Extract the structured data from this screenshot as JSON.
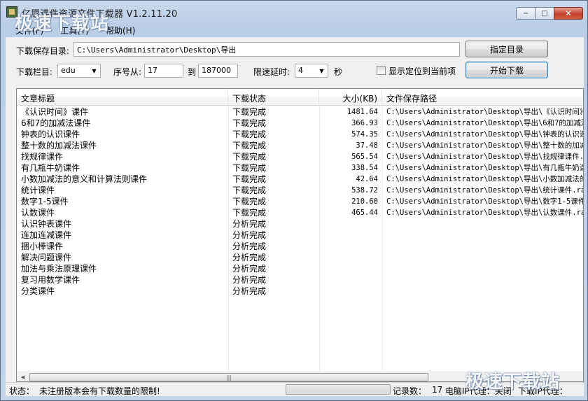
{
  "window": {
    "title": "亿愿课件资源文件下载器 V1.2.11.20",
    "watermark": "极速下载站",
    "minimize": "−",
    "maximize": "□",
    "close": "✕"
  },
  "menu": [
    "文件(F)",
    "工具(T)",
    "帮助(H)"
  ],
  "form": {
    "save_dir_label": "下载保存目录:",
    "save_dir_value": "C:\\Users\\Administrator\\Desktop\\导出",
    "choose_dir_button": "指定目录",
    "column_label": "下载栏目:",
    "column_value": "edu",
    "seq_from_label": "序号从:",
    "seq_from_value": "17",
    "seq_to_label": "到",
    "seq_to_value": "187000",
    "delay_label": "限速延时:",
    "delay_value": "4",
    "delay_unit": "秒",
    "locate_checkbox_label": "显示定位到当前项",
    "locate_checked": false,
    "start_button": "开始下载"
  },
  "table": {
    "headers": [
      "文章标题",
      "下载状态",
      "大小(KB)",
      "文件保存路径"
    ],
    "rows": [
      {
        "title": "《认识时间》课件",
        "status": "下载完成",
        "size": "1481.64",
        "path": "C:\\Users\\Administrator\\Desktop\\导出\\《认识时间》"
      },
      {
        "title": "6和7的加减法课件",
        "status": "下载完成",
        "size": "366.93",
        "path": "C:\\Users\\Administrator\\Desktop\\导出\\6和7的加减法"
      },
      {
        "title": "钟表的认识课件",
        "status": "下载完成",
        "size": "574.35",
        "path": "C:\\Users\\Administrator\\Desktop\\导出\\钟表的认识课"
      },
      {
        "title": "整十数的加减法课件",
        "status": "下载完成",
        "size": "37.48",
        "path": "C:\\Users\\Administrator\\Desktop\\导出\\整十数的加减"
      },
      {
        "title": "找规律课件",
        "status": "下载完成",
        "size": "565.54",
        "path": "C:\\Users\\Administrator\\Desktop\\导出\\找规律课件.ra"
      },
      {
        "title": "有几瓶牛奶课件",
        "status": "下载完成",
        "size": "338.54",
        "path": "C:\\Users\\Administrator\\Desktop\\导出\\有几瓶牛奶课"
      },
      {
        "title": "小数加减法的意义和计算法则课件",
        "status": "下载完成",
        "size": "42.64",
        "path": "C:\\Users\\Administrator\\Desktop\\导出\\小数加减法的"
      },
      {
        "title": "统计课件",
        "status": "下载完成",
        "size": "538.72",
        "path": "C:\\Users\\Administrator\\Desktop\\导出\\统计课件.rar"
      },
      {
        "title": "数字1-5课件",
        "status": "下载完成",
        "size": "210.60",
        "path": "C:\\Users\\Administrator\\Desktop\\导出\\数字1-5课件.r"
      },
      {
        "title": "认数课件",
        "status": "下载完成",
        "size": "465.44",
        "path": "C:\\Users\\Administrator\\Desktop\\导出\\认数课件.rar"
      },
      {
        "title": "认识钟表课件",
        "status": "分析完成",
        "size": "",
        "path": ""
      },
      {
        "title": "连加连减课件",
        "status": "分析完成",
        "size": "",
        "path": ""
      },
      {
        "title": "捆小棒课件",
        "status": "分析完成",
        "size": "",
        "path": ""
      },
      {
        "title": "解决问题课件",
        "status": "分析完成",
        "size": "",
        "path": ""
      },
      {
        "title": "加法与乘法原理课件",
        "status": "分析完成",
        "size": "",
        "path": ""
      },
      {
        "title": "复习用数学课件",
        "status": "分析完成",
        "size": "",
        "path": ""
      },
      {
        "title": "分类课件",
        "status": "分析完成",
        "size": "",
        "path": ""
      }
    ]
  },
  "status": {
    "label": "状态：",
    "message": "未注册版本会有下载数量的限制!",
    "records_label": "记录数：",
    "records_value": "17",
    "proxy_text": "电脑IP代理：关闭",
    "download_text": "下载IP代理："
  }
}
